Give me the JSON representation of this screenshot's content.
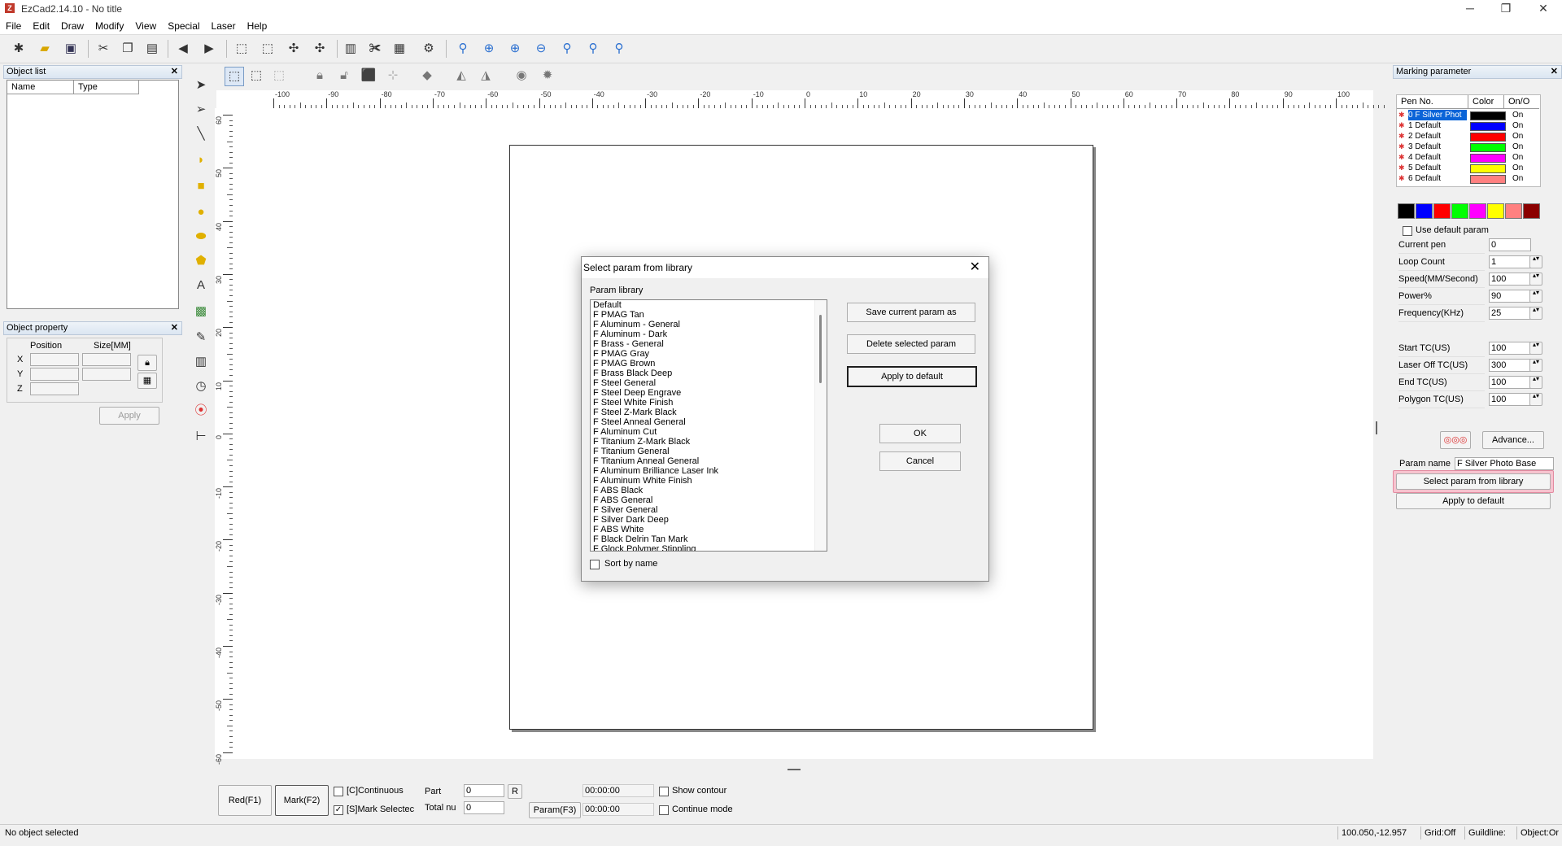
{
  "window": {
    "title": "EzCad2.14.10 - No title",
    "app_icon": "Z",
    "minimize": "─",
    "maximize": "❐",
    "close": "✕"
  },
  "menu": [
    "File",
    "Edit",
    "Draw",
    "Modify",
    "View",
    "Special",
    "Laser",
    "Help"
  ],
  "object_list": {
    "title": "Object list",
    "col_name": "Name",
    "col_type": "Type"
  },
  "object_property": {
    "title": "Object property",
    "col_position": "Position",
    "col_size": "Size[MM]",
    "x": "X",
    "y": "Y",
    "z": "Z",
    "apply": "Apply"
  },
  "ruler": {
    "h_ticks": [
      "-100",
      "-90",
      "-80",
      "-70",
      "-60",
      "-50",
      "-40",
      "-30",
      "-20",
      "-10",
      "0",
      "10",
      "20",
      "30",
      "40",
      "50",
      "60",
      "70",
      "80",
      "90",
      "100"
    ],
    "v_ticks": [
      "60",
      "50",
      "40",
      "30",
      "20",
      "10",
      "0",
      "-10",
      "-20",
      "-30",
      "-40",
      "-50",
      "-60"
    ]
  },
  "dialog": {
    "title": "Select param from library",
    "library_label": "Param library",
    "items": [
      "Default",
      "F PMAG Tan",
      "F Aluminum - General",
      "F Aluminum - Dark",
      "F Brass - General",
      "F PMAG Gray",
      "F PMAG Brown",
      "F Brass Black Deep",
      "F Steel General",
      "F Steel Deep Engrave",
      "F Steel White Finish",
      "F Steel Z-Mark Black",
      "F Steel Anneal General",
      "F Aluminum Cut",
      "F Titanium Z-Mark Black",
      "F Titanium General",
      "F Titanium Anneal General",
      "F Aluminum Brilliance Laser Ink",
      "F Aluminum White Finish",
      "F ABS Black",
      "F ABS General",
      "F Silver General",
      "F Silver Dark Deep",
      "F ABS White",
      "F Black Delrin Tan Mark",
      "F Glock Polymer Stippling"
    ],
    "save_btn": "Save current param as",
    "delete_btn": "Delete selected param",
    "apply_btn": "Apply to default",
    "ok_btn": "OK",
    "cancel_btn": "Cancel",
    "sort_label": "Sort by name"
  },
  "marking": {
    "title": "Marking parameter",
    "col_pen": "Pen No.",
    "col_color": "Color",
    "col_onoff": "On/O",
    "pens": [
      {
        "name": "0 F Silver Phot",
        "color": "#000000",
        "state": "On"
      },
      {
        "name": "1 Default",
        "color": "#0000ff",
        "state": "On"
      },
      {
        "name": "2 Default",
        "color": "#ff0000",
        "state": "On"
      },
      {
        "name": "3 Default",
        "color": "#00ff00",
        "state": "On"
      },
      {
        "name": "4 Default",
        "color": "#ff00ff",
        "state": "On"
      },
      {
        "name": "5 Default",
        "color": "#ffff00",
        "state": "On"
      },
      {
        "name": "6 Default",
        "color": "#ff8080",
        "state": "On"
      }
    ],
    "palette": [
      "#000000",
      "#0000ff",
      "#ff0000",
      "#00ff00",
      "#ff00ff",
      "#ffff00",
      "#ff8080",
      "#8b0000"
    ],
    "use_default": "Use default param",
    "params": [
      {
        "label": "Current pen",
        "value": "0"
      },
      {
        "label": "Loop Count",
        "value": "1"
      },
      {
        "label": "Speed(MM/Second)",
        "value": "100"
      },
      {
        "label": "Power%",
        "value": "90"
      },
      {
        "label": "Frequency(KHz)",
        "value": "25"
      }
    ],
    "tc": [
      {
        "label": "Start TC(US)",
        "value": "100"
      },
      {
        "label": "Laser Off TC(US)",
        "value": "300"
      },
      {
        "label": "End TC(US)",
        "value": "100"
      },
      {
        "label": "Polygon TC(US)",
        "value": "100"
      }
    ],
    "advance": "Advance...",
    "param_name_label": "Param name",
    "param_name_value": "F Silver Photo Base",
    "select_lib": "Select param from library",
    "apply_default": "Apply to default"
  },
  "bottom": {
    "red": "Red(F1)",
    "mark": "Mark(F2)",
    "continuous": "[C]Continuous",
    "mark_selected": "[S]Mark Selectec",
    "part_label": "Part",
    "part_value": "0",
    "r_btn": "R",
    "total_label": "Total nu",
    "total_value": "0",
    "time1": "00:00:00",
    "time2": "00:00:00",
    "param_btn": "Param(F3)",
    "show_contour": "Show contour",
    "continue_mode": "Continue mode"
  },
  "status": {
    "left": "No object selected",
    "coords": "100.050,-12.957",
    "grid": "Grid:Off",
    "guide": "Guildline:",
    "object": "Object:Or"
  }
}
